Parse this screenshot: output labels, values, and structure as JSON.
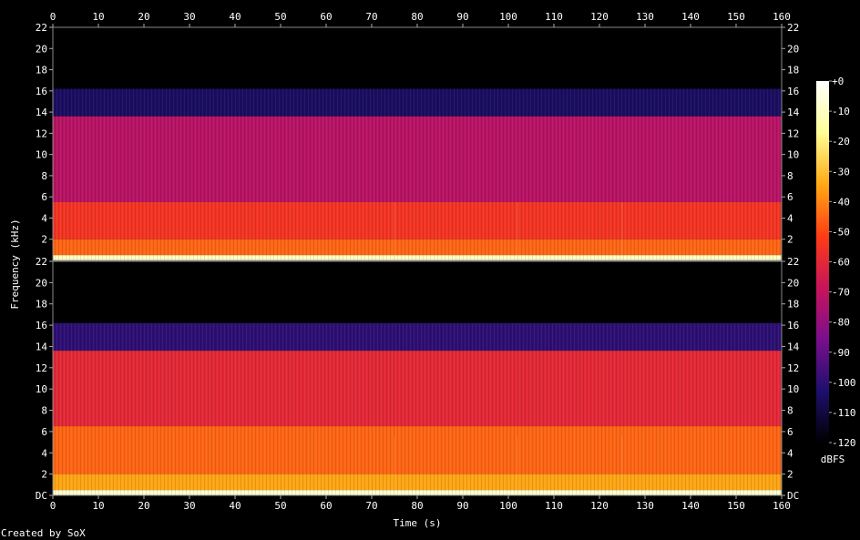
{
  "chart_data": {
    "type": "heatmap",
    "title": "",
    "xlabel": "Time (s)",
    "ylabel": "Frequency (kHz)",
    "xlim": [
      0,
      160
    ],
    "ylim": [
      0,
      22
    ],
    "x_ticks": [
      "0",
      "10",
      "20",
      "30",
      "40",
      "50",
      "60",
      "70",
      "80",
      "90",
      "100",
      "110",
      "120",
      "130",
      "140",
      "150",
      "160"
    ],
    "y_ticks": [
      "DC",
      "2",
      "4",
      "6",
      "8",
      "10",
      "12",
      "14",
      "16",
      "18",
      "20",
      "22"
    ],
    "channels": [
      {
        "bands": [
          {
            "from_khz": 16.2,
            "to_khz": 22,
            "level_dbfs": -130
          },
          {
            "from_khz": 13.6,
            "to_khz": 16.2,
            "level_dbfs": -105
          },
          {
            "from_khz": 5.5,
            "to_khz": 13.6,
            "level_dbfs": -72
          },
          {
            "from_khz": 2.0,
            "to_khz": 5.5,
            "level_dbfs": -55
          },
          {
            "from_khz": 0.5,
            "to_khz": 2.0,
            "level_dbfs": -45
          },
          {
            "from_khz": 0,
            "to_khz": 0.5,
            "level_dbfs": -10
          }
        ]
      },
      {
        "bands": [
          {
            "from_khz": 16.2,
            "to_khz": 22,
            "level_dbfs": -130
          },
          {
            "from_khz": 13.6,
            "to_khz": 16.2,
            "level_dbfs": -100
          },
          {
            "from_khz": 6.5,
            "to_khz": 13.6,
            "level_dbfs": -60
          },
          {
            "from_khz": 2.0,
            "to_khz": 6.5,
            "level_dbfs": -45
          },
          {
            "from_khz": 0.5,
            "to_khz": 2.0,
            "level_dbfs": -35
          },
          {
            "from_khz": 0,
            "to_khz": 0.5,
            "level_dbfs": -8
          }
        ]
      }
    ],
    "segment_boundaries_s": [
      75,
      102,
      125
    ],
    "colorbar": {
      "label": "dBFS",
      "ticks": [
        "+0",
        "-10",
        "-20",
        "-30",
        "-40",
        "-50",
        "-60",
        "-70",
        "-80",
        "-90",
        "-100",
        "-110",
        "-120"
      ],
      "range": [
        -120,
        0
      ]
    },
    "colors": {
      "stop0": "#000000",
      "stop1": "#1e0f6e",
      "stop2": "#7a0f8c",
      "stop3": "#c8145a",
      "stop4": "#ff3c14",
      "stop5": "#ffaa14",
      "stop6": "#ffff96",
      "stop7": "#ffffff"
    }
  },
  "footer": {
    "credit": "Created by SoX"
  }
}
